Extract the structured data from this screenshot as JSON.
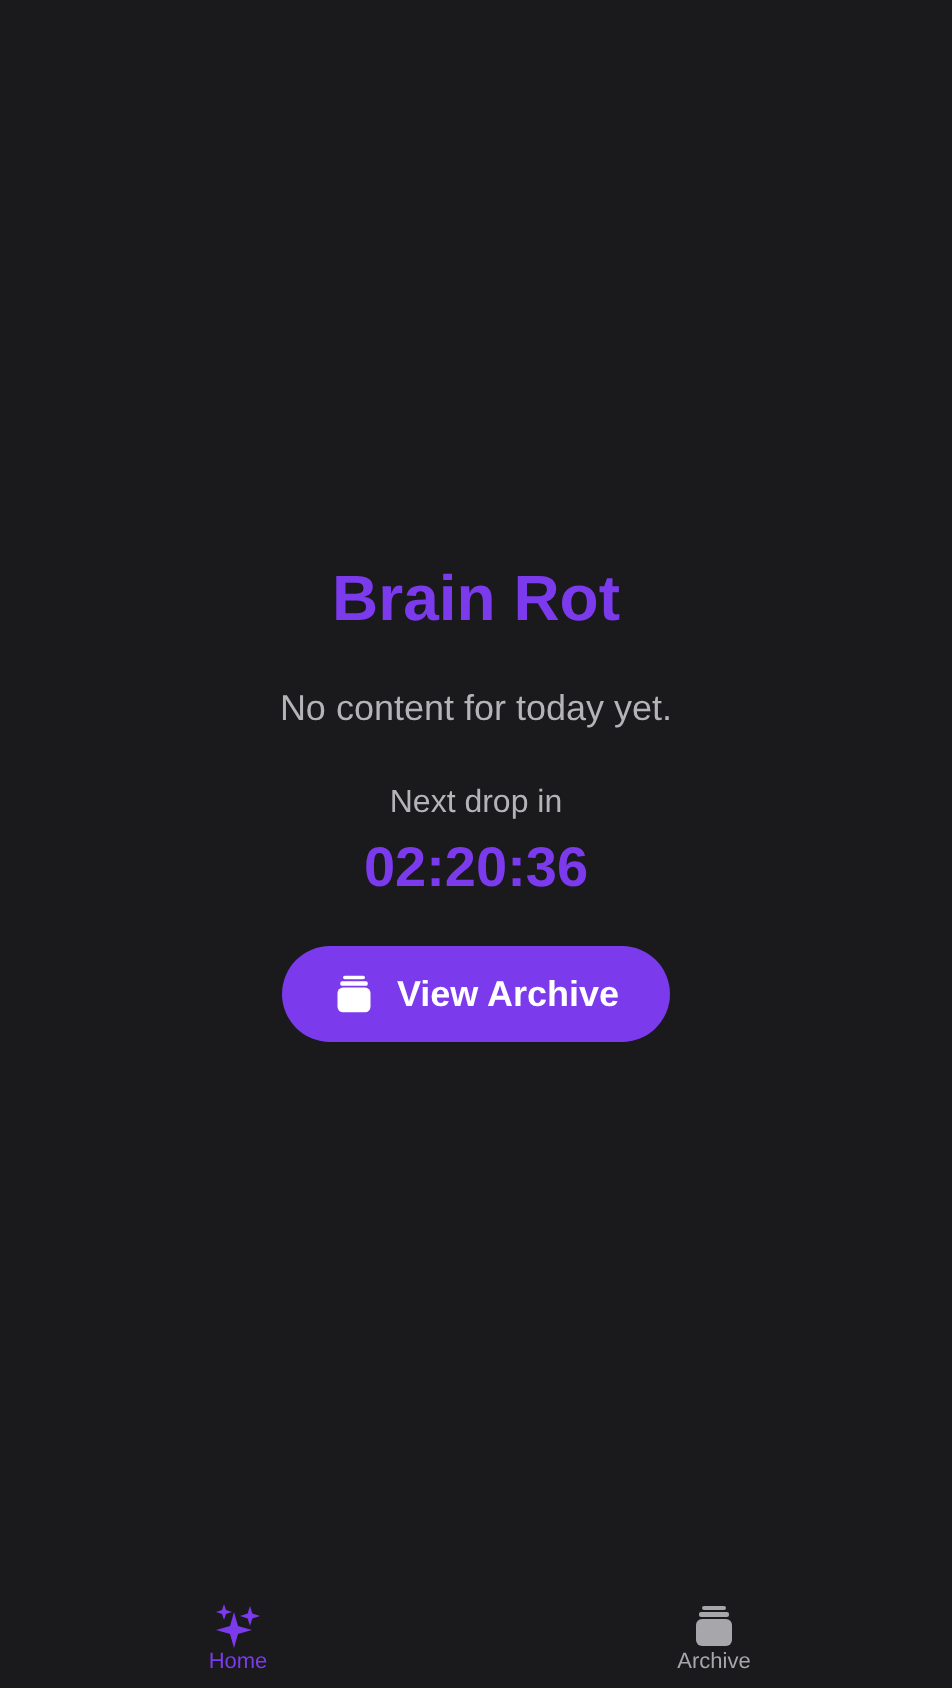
{
  "title": "Brain Rot",
  "message": "No content for today yet.",
  "countdown": {
    "label": "Next drop in",
    "time": "02:20:36"
  },
  "archive_button": {
    "label": "View Archive"
  },
  "tabs": [
    {
      "label": "Home",
      "kind": "sparkles",
      "selected": true
    },
    {
      "label": "Archive",
      "kind": "archive",
      "selected": false
    }
  ]
}
